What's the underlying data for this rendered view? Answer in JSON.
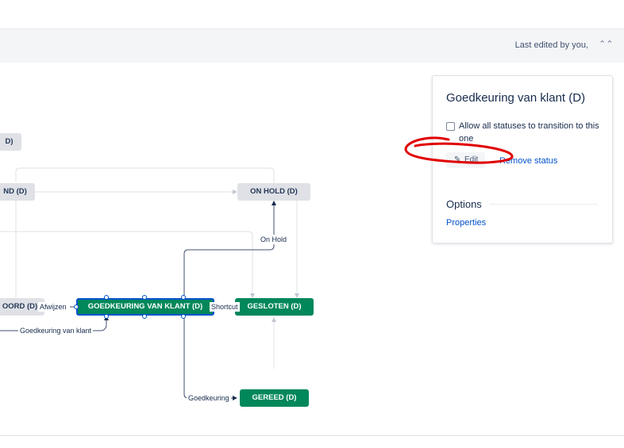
{
  "header": {
    "last_edited": "Last edited by you,",
    "collapse_icon": "chevron-double-up-icon"
  },
  "diagram": {
    "nodes": {
      "partial_top": "D)",
      "partial_mid": "ND (D)",
      "on_hold": "ON HOLD (D)",
      "partial_left": "OORD (D)",
      "goedkeuring_klant": "GOEDKEURING VAN KLANT (D)",
      "gesloten": "GESLOTEN (D)",
      "gereed": "GEREED (D)"
    },
    "transitions": {
      "on_hold": "On Hold",
      "afwijzen": "Afwijzen",
      "shortcut": "Shortcut",
      "goedkeuring_van_klant": "Goedkeuring van klant",
      "goedkeuring": "Goedkeuring"
    }
  },
  "panel": {
    "title": "Goedkeuring van klant (D)",
    "allow_all_label": "Allow all statuses to transition to this one",
    "edit_label": "Edit",
    "remove_label": "Remove status",
    "options_heading": "Options",
    "properties_link": "Properties"
  },
  "colors": {
    "status_green": "#00875a",
    "status_grey": "#dfe1e6",
    "link_blue": "#0052cc",
    "annotation_red": "#e00000"
  }
}
